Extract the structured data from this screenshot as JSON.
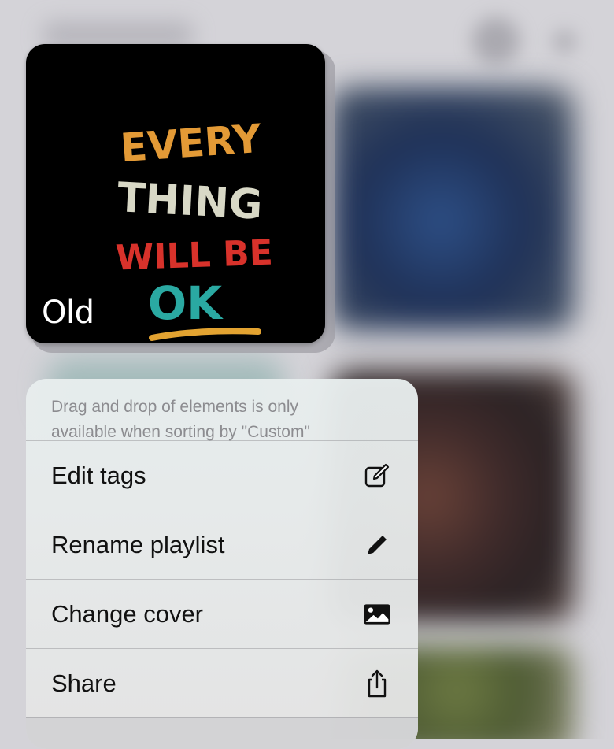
{
  "cover": {
    "label": "Old",
    "art_words": [
      "EVERY",
      "THING",
      "WILL BE",
      "OK"
    ],
    "art_colors": {
      "every": "#e39a36",
      "thing": "#d8d8c6",
      "willbe": "#d8322b",
      "ok": "#2aa9a2",
      "underline": "#e3a331"
    }
  },
  "menu": {
    "note_line1": "Drag and drop of elements is only",
    "note_line2": "available when sorting by \"Custom\"",
    "items": [
      {
        "label": "Edit tags",
        "icon": "edit-tags-icon"
      },
      {
        "label": "Rename playlist",
        "icon": "pencil-icon"
      },
      {
        "label": "Change cover",
        "icon": "photo-icon"
      },
      {
        "label": "Share",
        "icon": "share-icon"
      }
    ]
  }
}
